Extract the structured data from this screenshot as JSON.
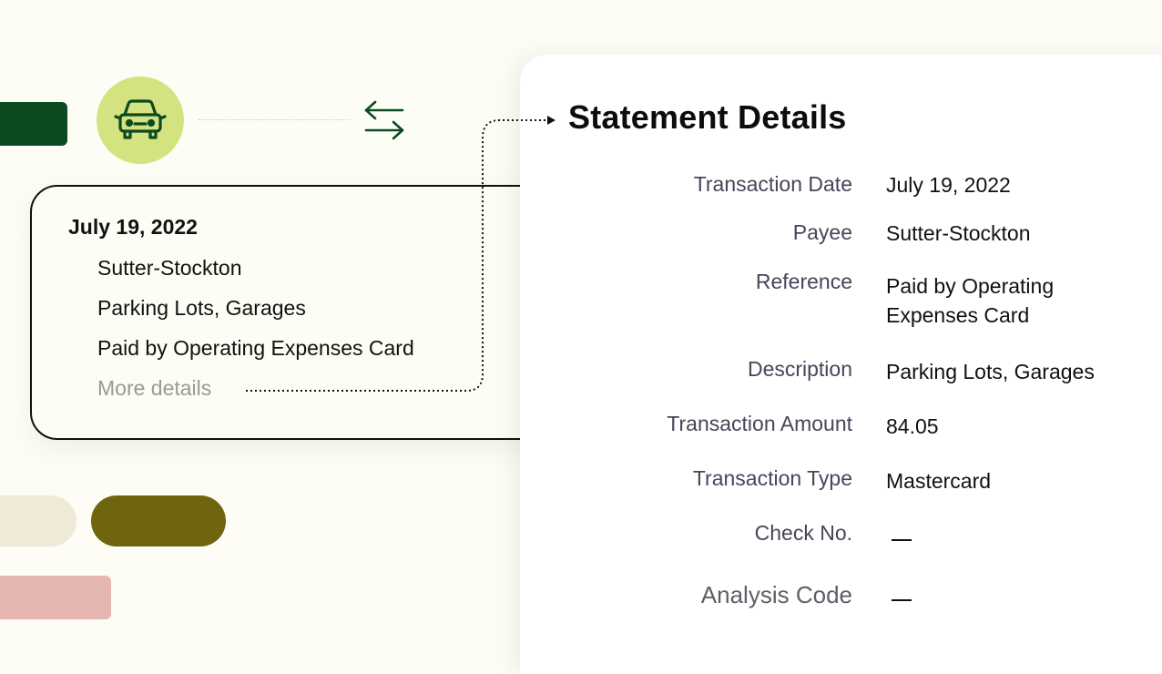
{
  "card": {
    "date": "July 19, 2022",
    "lines": [
      "Sutter-Stockton",
      "Parking Lots, Garages",
      "Paid by Operating Expenses Card"
    ],
    "more_details": "More details"
  },
  "panel": {
    "title": "Statement Details",
    "rows": [
      {
        "label": "Transaction Date",
        "value": "July 19, 2022"
      },
      {
        "label": "Payee",
        "value": "Sutter-Stockton"
      },
      {
        "label": "Reference",
        "value": "Paid by Operating Expenses Card"
      },
      {
        "label": "Description",
        "value": "Parking Lots, Garages"
      },
      {
        "label": "Transaction Amount",
        "value": "84.05"
      },
      {
        "label": "Transaction Type",
        "value": "Mastercard"
      },
      {
        "label": "Check No.",
        "value": ""
      },
      {
        "label": "Analysis Code",
        "value": ""
      }
    ]
  },
  "icons": {
    "car": "car-icon",
    "swap": "swap-arrows-icon"
  },
  "colors": {
    "brand_green": "#0b4a21",
    "lime": "#d4e37f",
    "olive": "#6e650e",
    "rose": "#e6b6b1",
    "cream": "#efe9d8"
  }
}
